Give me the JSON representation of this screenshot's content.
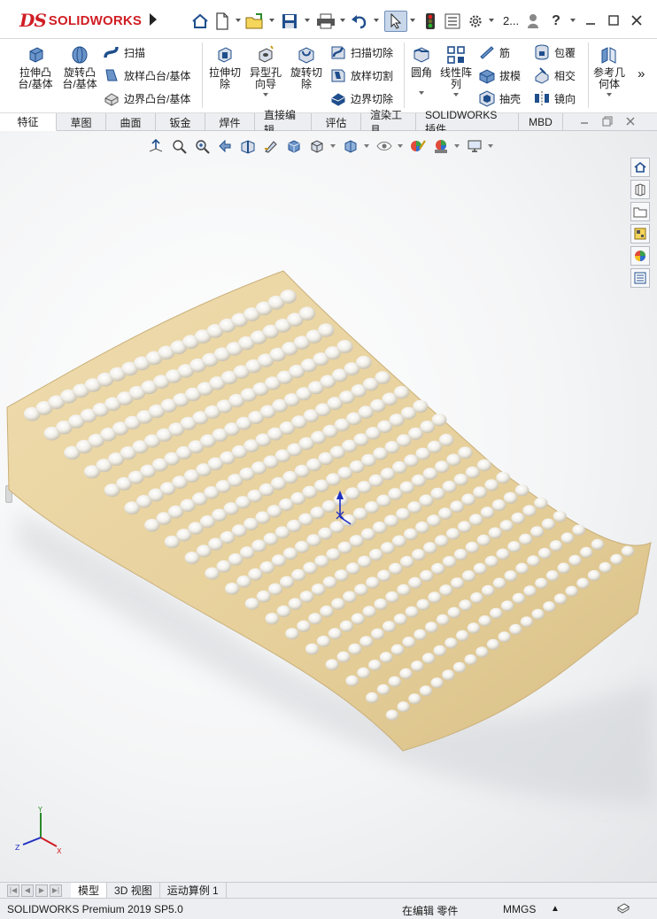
{
  "app": {
    "brand_prefix": "DS",
    "brand_name": "SOLIDWORKS",
    "user_short": "2..."
  },
  "ribbon": {
    "big_buttons": [
      {
        "label": "拉伸凸\n台/基体"
      },
      {
        "label": "旋转凸\n台/基体"
      },
      {
        "label": "拉伸切\n除"
      },
      {
        "label": "异型孔\n向导"
      },
      {
        "label": "旋转切\n除"
      },
      {
        "label": "圆角"
      },
      {
        "label": "线性阵\n列"
      },
      {
        "label": "参考几\n何体"
      }
    ],
    "small_buttons": [
      {
        "label": "扫描"
      },
      {
        "label": "放样凸台/基体"
      },
      {
        "label": "边界凸台/基体"
      },
      {
        "label": "扫描切除"
      },
      {
        "label": "放样切割"
      },
      {
        "label": "边界切除"
      },
      {
        "label": "筋"
      },
      {
        "label": "拔模"
      },
      {
        "label": "抽壳"
      },
      {
        "label": "包覆"
      },
      {
        "label": "相交"
      },
      {
        "label": "镜向"
      }
    ],
    "overflow": "»"
  },
  "tabs": [
    {
      "label": "特征",
      "active": true
    },
    {
      "label": "草图"
    },
    {
      "label": "曲面"
    },
    {
      "label": "钣金"
    },
    {
      "label": "焊件"
    },
    {
      "label": "直接编辑"
    },
    {
      "label": "评估"
    },
    {
      "label": "渲染工具"
    },
    {
      "label": "SOLIDWORKS 插件"
    },
    {
      "label": "MBD"
    }
  ],
  "viewport": {
    "model_color": "#e8d2a0",
    "bump_color": "#f2f0ea",
    "triad": {
      "x": "X",
      "y": "Y",
      "z": "Z"
    }
  },
  "bottom_tabs": [
    {
      "label": "模型",
      "active": true
    },
    {
      "label": "3D 视图"
    },
    {
      "label": "运动算例 1"
    }
  ],
  "status": {
    "product": "SOLIDWORKS Premium 2019 SP5.0",
    "mode": "在编辑 零件",
    "units": "MMGS",
    "units_arrow": "▲"
  },
  "colors": {
    "brand_red": "#d01e24",
    "accent_blue": "#2b5ea8"
  }
}
